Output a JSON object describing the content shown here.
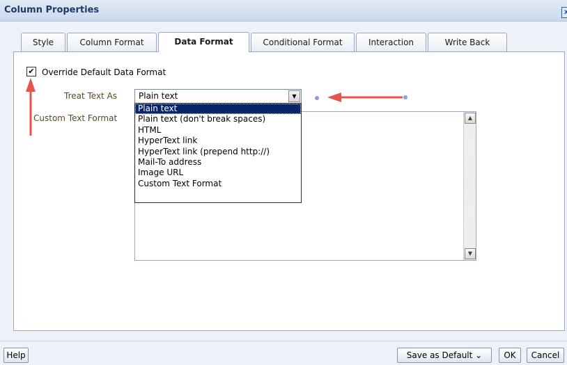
{
  "dialog": {
    "title": "Column Properties",
    "close_label": "x"
  },
  "tabs": [
    {
      "label": "Style",
      "active": false
    },
    {
      "label": "Column Format",
      "active": false
    },
    {
      "label": "Data Format",
      "active": true
    },
    {
      "label": "Conditional Format",
      "active": false
    },
    {
      "label": "Interaction",
      "active": false
    },
    {
      "label": "Write Back",
      "active": false
    }
  ],
  "data_format": {
    "override_checkbox": {
      "label": "Override Default Data Format",
      "checked": true
    },
    "treat_text_as": {
      "label": "Treat Text As",
      "value": "Plain text",
      "options": [
        "Plain text",
        "Plain text (don't break spaces)",
        "HTML",
        "HyperText link",
        "HyperText link (prepend http://)",
        "Mail-To address",
        "Image URL",
        "Custom Text Format"
      ]
    },
    "custom_text_format": {
      "label": "Custom Text Format",
      "value": ""
    }
  },
  "footer": {
    "help_label": "Help",
    "save_default_label": "Save as Default ⌄",
    "ok_label": "OK",
    "cancel_label": "Cancel"
  },
  "colors": {
    "annotation_arrow": "#e8544a",
    "selected_option_bg": "#0a246a",
    "annotation_dot": "#9a9cc8"
  }
}
